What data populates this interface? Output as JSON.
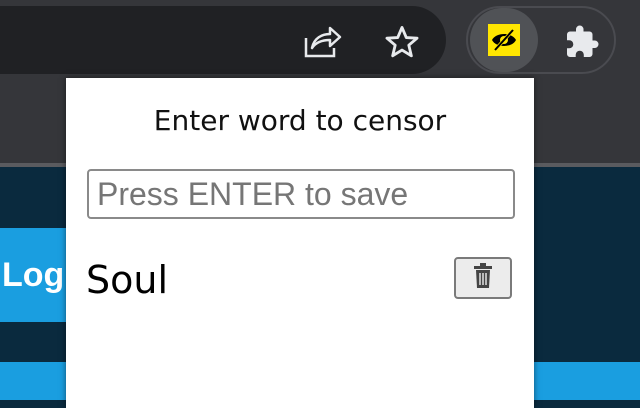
{
  "browser": {
    "toolbar_icons": [
      "share-icon",
      "star-icon",
      "eye-slash-icon",
      "puzzle-icon"
    ],
    "extension_color": "#ffe600"
  },
  "page": {
    "login_text": "Log"
  },
  "popup": {
    "title": "Enter word to censor",
    "input": {
      "placeholder": "Press ENTER to save",
      "value": ""
    },
    "words": [
      {
        "text": "Soul",
        "delete_icon": "trash-icon"
      }
    ]
  }
}
